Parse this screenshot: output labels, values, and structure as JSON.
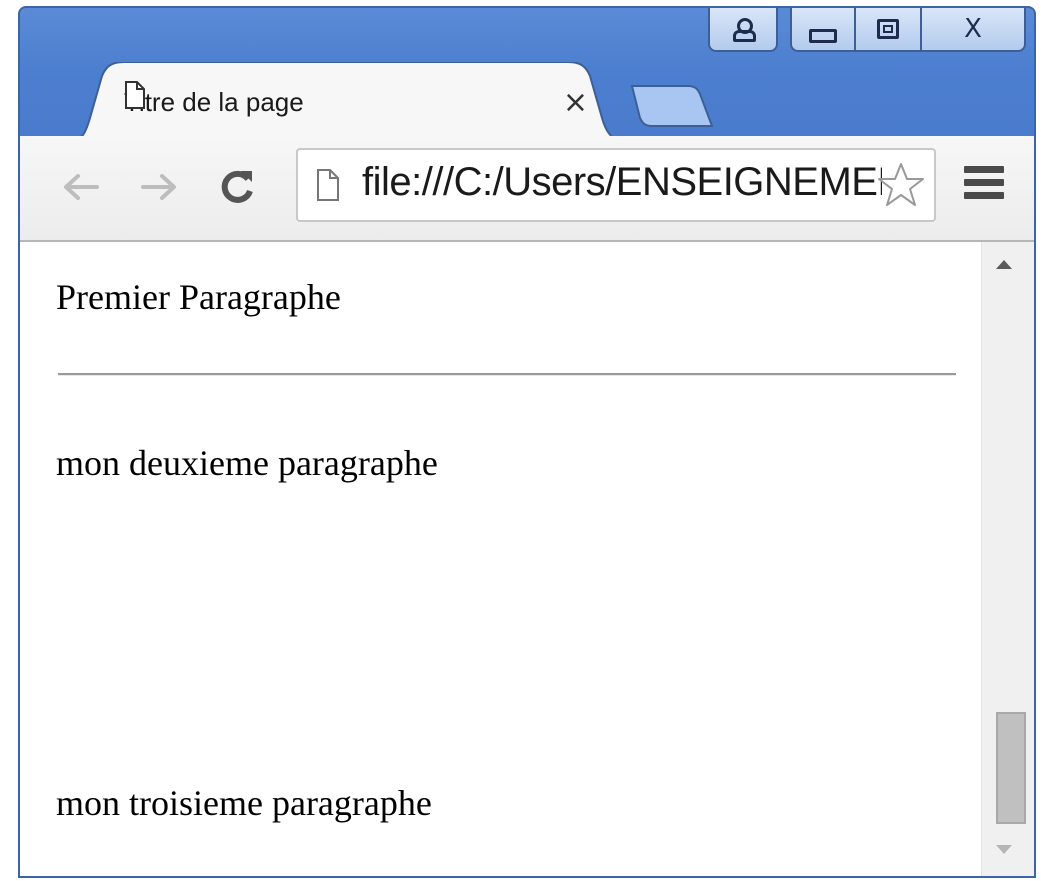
{
  "window": {
    "controls": [
      "user-icon",
      "minimize-icon",
      "maximize-icon",
      "close-icon"
    ],
    "close_label": "X"
  },
  "tab": {
    "title": "Titre de la page",
    "close_label": "×"
  },
  "toolbar": {
    "back": "←",
    "forward": "→",
    "reload": "C",
    "url": "file:///C:/Users/ENSEIGNEMENT"
  },
  "page": {
    "paragraphs": [
      "Premier Paragraphe",
      "mon deuxieme paragraphe",
      "mon troisieme paragraphe"
    ]
  },
  "colors": {
    "frame": "#4a7bcc",
    "toolbar": "#f2f2f2",
    "hr": "#9a9a9a"
  }
}
